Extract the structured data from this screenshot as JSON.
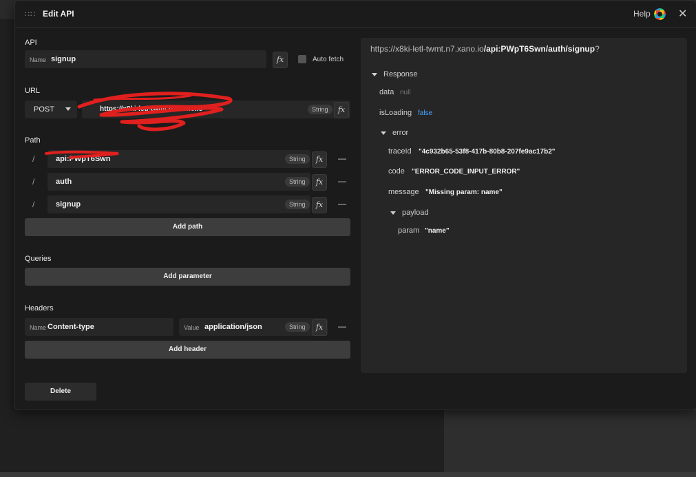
{
  "modal": {
    "title": "Edit API",
    "help_label": "Help",
    "close_glyph": "✕",
    "drag_glyph": "∷∷"
  },
  "api": {
    "section_label": "API",
    "name_prefix": "Name",
    "name_value": "signup",
    "fx_label": "fx",
    "auto_fetch_label": "Auto fetch"
  },
  "url": {
    "section_label": "URL",
    "method": "POST",
    "value": "https://x8ki-letl-twmt.n7.xano.io",
    "type_tag": "String",
    "fx_label": "fx"
  },
  "path": {
    "section_label": "Path",
    "segments": [
      {
        "slash": "/",
        "value": "api:PWpT6Swn",
        "type_tag": "String",
        "fx_label": "fx",
        "remove": "—"
      },
      {
        "slash": "/",
        "value": "auth",
        "type_tag": "String",
        "fx_label": "fx",
        "remove": "—"
      },
      {
        "slash": "/",
        "value": "signup",
        "type_tag": "String",
        "fx_label": "fx",
        "remove": "—"
      }
    ],
    "add_label": "Add path"
  },
  "queries": {
    "section_label": "Queries",
    "add_label": "Add parameter"
  },
  "headers": {
    "section_label": "Headers",
    "name_prefix": "Name",
    "name_value": "Content-type",
    "value_prefix": "Value",
    "value_value": "application/json",
    "type_tag": "String",
    "fx_label": "fx",
    "remove": "—",
    "add_label": "Add header"
  },
  "delete_label": "Delete",
  "response_panel": {
    "url_base": "https://x8ki-letl-twmt.n7.xano.io",
    "url_path": "/api:PWpT6Swn/auth/signup",
    "url_suffix": "?",
    "root_label": "Response",
    "data_key": "data",
    "data_val": "null",
    "isloading_key": "isLoading",
    "isloading_val": "false",
    "error_key": "error",
    "traceid_key": "traceId",
    "traceid_val": "\"4c932b65-53f8-417b-80b8-207fe9ac17b2\"",
    "code_key": "code",
    "code_val": "\"ERROR_CODE_INPUT_ERROR\"",
    "message_key": "message",
    "message_val": "\"Missing param: name\"",
    "payload_key": "payload",
    "param_key": "param",
    "param_val": "\"name\""
  },
  "colors": {
    "accent_blue": "#4aa3ff",
    "scribble_red": "#e0201e",
    "button_gray": "#3d3d3d"
  }
}
